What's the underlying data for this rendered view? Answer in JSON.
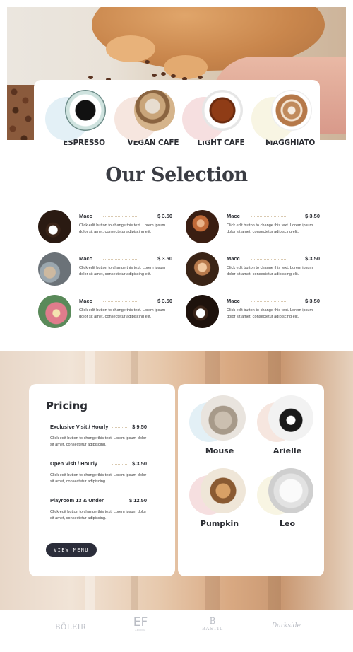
{
  "drinks": [
    {
      "label": "ESPRESSO",
      "blob": "#e3f0f6"
    },
    {
      "label": "VEGAN CAFE",
      "blob": "#f6e6df"
    },
    {
      "label": "LIGHT CAFE",
      "blob": "#f6dfe0"
    },
    {
      "label": "MAGGHIATO",
      "blob": "#f8f5e3"
    }
  ],
  "selection": {
    "title": "Our Selection",
    "items": [
      {
        "name": "Macc",
        "price": "$ 3.50",
        "desc": "Click edit button to change this text. Lorem ipsum dolor sit amet, consectetur adipiscing elit."
      },
      {
        "name": "Macc",
        "price": "$ 3.50",
        "desc": "Click edit button to change this text. Lorem ipsum dolor sit amet, consectetur adipiscing elit."
      },
      {
        "name": "Macc",
        "price": "$ 3.50",
        "desc": "Click edit button to change this text. Lorem ipsum dolor sit amet, consectetur adipiscing elit."
      },
      {
        "name": "Macc",
        "price": "$ 3.50",
        "desc": "Click edit button to change this text. Lorem ipsum dolor sit amet, consectetur adipiscing elit."
      },
      {
        "name": "Macc",
        "price": "$ 3.50",
        "desc": "Click edit button to change this text. Lorem ipsum dolor sit amet, consectetur adipiscing elit."
      },
      {
        "name": "Macc",
        "price": "$ 3.50",
        "desc": "Click edit button to change this text. Lorem ipsum dolor sit amet, consectetur adipiscing elit."
      }
    ]
  },
  "pricing": {
    "title": "Pricing",
    "rows": [
      {
        "name": "Exclusive Visit / Hourly",
        "price": "$ 9.50",
        "desc": "Click edit button to change this text. Lorem ipsum dolor sit amet, consectetur adipiscing."
      },
      {
        "name": "Open Visit / Hourly",
        "price": "$ 3.50",
        "desc": "Click edit button to change this text. Lorem ipsum dolor sit amet, consectetur adipiscing."
      },
      {
        "name": "Playroom 13 & Under",
        "price": "$ 12.50",
        "desc": "Click edit button to change this text. Lorem ipsum dolor sit amet, consectetur adipiscing."
      }
    ],
    "button": "VIEW MENU"
  },
  "cats": [
    {
      "name": "Mouse",
      "blob": "#e3f0f6"
    },
    {
      "name": "Arielle",
      "blob": "#f6e6df"
    },
    {
      "name": "Pumpkin",
      "blob": "#f6dfe0"
    },
    {
      "name": "Leo",
      "blob": "#f8f5e3"
    }
  ],
  "logos": [
    "BÖLEIR",
    "EF",
    "ARDIFIA",
    "B",
    "BASTIL",
    "Darkside"
  ]
}
